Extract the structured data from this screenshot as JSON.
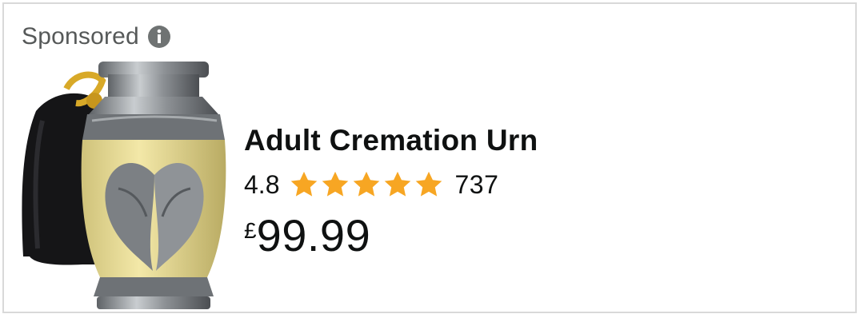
{
  "sponsored_label": "Sponsored",
  "icons": {
    "info": "info-icon",
    "star": "star-icon"
  },
  "product": {
    "title": "Adult Cremation Urn",
    "rating": "4.8",
    "stars_out_of_5": 4.8,
    "review_count": "737",
    "price_currency": "£",
    "price_amount": "99.99",
    "image_alt": "Adult cremation urn with angel wings and velvet bag"
  },
  "colors": {
    "star_fill": "#f7a623",
    "text_primary": "#0f1111",
    "text_secondary": "#565959",
    "card_border": "#d9d9d9"
  }
}
